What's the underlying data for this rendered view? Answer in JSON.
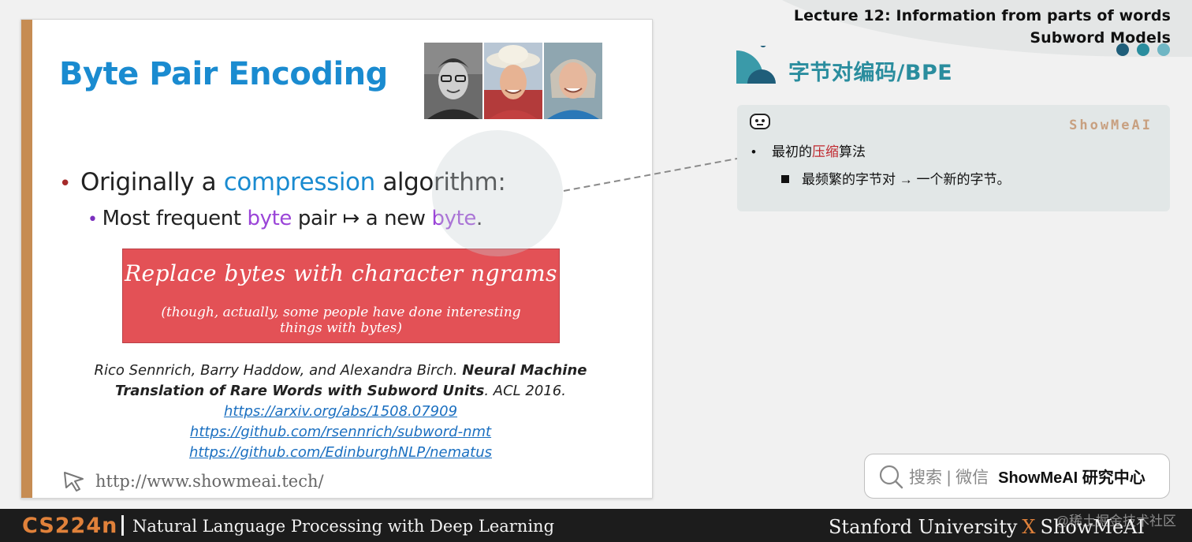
{
  "header": {
    "lecture_line1": "Lecture 12: Information from parts of words",
    "lecture_line2": "Subword Models",
    "dot_colors": [
      "#1f5e7a",
      "#2a8d9e",
      "#6fb6c4"
    ]
  },
  "slide": {
    "title": "Byte Pair Encoding",
    "bullet1": {
      "pre": "Originally a ",
      "highlight": "compression",
      "post": " algorithm:"
    },
    "bullet2": {
      "pre": "Most frequent ",
      "h1": "byte",
      "mid": " pair ↦ a new ",
      "h2": "byte",
      "post": "."
    },
    "box_title": "Replace bytes with character ngrams",
    "box_sub": "(though, actually, some people have done interesting things with bytes)",
    "citation_authors": "Rico Sennrich, Barry Haddow, and Alexandra Birch. ",
    "citation_title": "Neural Machine Translation of Rare Words with Subword Units",
    "citation_venue": ". ACL 2016.",
    "links": [
      "https://arxiv.org/abs/1508.07909",
      "https://github.com/rsennrich/subword-nmt",
      "https://github.com/EdinburghNLP/nematus"
    ],
    "site_url": "http://www.showmeai.tech/"
  },
  "notes": {
    "section_title": "字节对编码/BPE",
    "brand": "ShowMeAI",
    "line1_pre": "最初的",
    "line1_red": "压缩",
    "line1_post": "算法",
    "line2": "最频繁的字节对 → 一个新的字节。"
  },
  "search": {
    "hint": "搜索 | 微信",
    "brand": "ShowMeAI 研究中心"
  },
  "footer": {
    "course_code": "CS224n",
    "course_name": "Natural Language Processing with Deep Learning",
    "university": "Stanford University",
    "x": "X",
    "brand": "ShowMeAI",
    "watermark": "@稀土掘金技术社区"
  },
  "colors": {
    "accent_blue": "#1a8bd0",
    "accent_purple": "#9b45d8",
    "accent_teal": "#2a8d9e",
    "accent_orange": "#e0813a",
    "box_red": "#e35156"
  }
}
